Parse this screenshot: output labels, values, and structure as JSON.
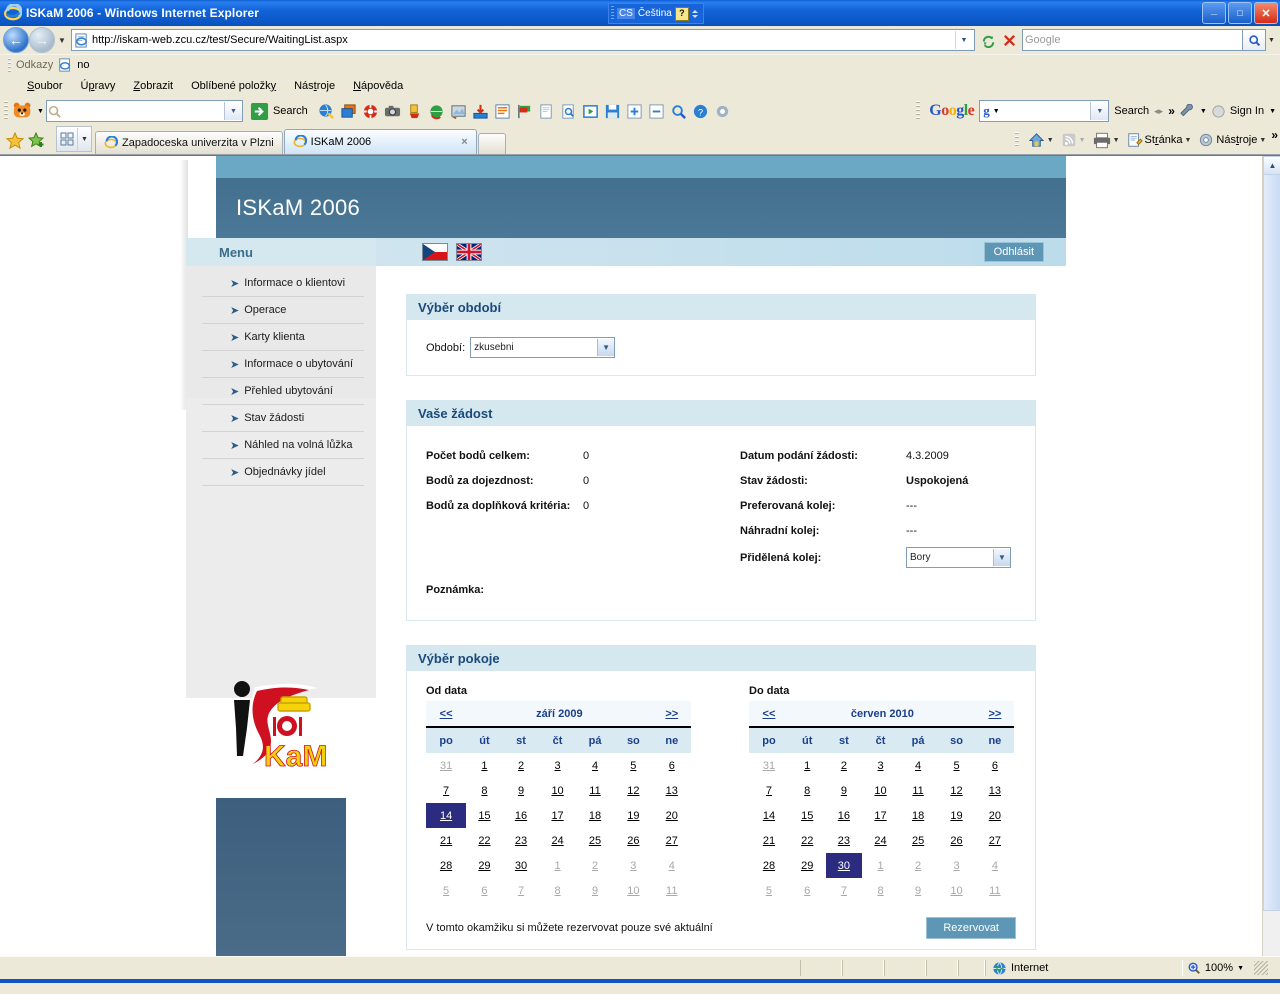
{
  "window": {
    "title": "ISKaM 2006 - Windows Internet Explorer",
    "ie_icon": "internet-explorer-icon",
    "minimize_label": "_",
    "maximize_label": "□",
    "close_label": "×",
    "lang_indicator": {
      "code": "CS",
      "name": "Čeština",
      "help": "?"
    }
  },
  "address_bar": {
    "url": "http://iskam-web.zcu.cz/test/Secure/WaitingList.aspx",
    "search_placeholder": "Google",
    "back_label": "←",
    "forward_label": "→",
    "refresh_label": "refresh-icon",
    "stop_label": "stop-icon",
    "go_label": "search-icon"
  },
  "links_bar": {
    "label": "Odkazy",
    "item": "no"
  },
  "menu_bar": {
    "items": [
      "Soubor",
      "Úpravy",
      "Zobrazit",
      "Oblíbené položky",
      "Nástroje",
      "Nápověda"
    ]
  },
  "toolbar": {
    "search_label": "Search",
    "search_value": "",
    "icons": [
      "globe-search-icon",
      "windows-icon",
      "lifebuoy-icon",
      "camera-icon",
      "highlighter-icon",
      "world-refresh-icon",
      "image-edit-icon",
      "download-icon",
      "list-icon",
      "flag-icon",
      "page-icon",
      "page-search-icon",
      "media-icon",
      "save-icon",
      "zoom-in-icon",
      "zoom-out-icon",
      "magnifier-icon",
      "help-icon",
      "gear-icon"
    ]
  },
  "google_bar": {
    "logo": [
      "G",
      "o",
      "o",
      "g",
      "l",
      "e"
    ],
    "box_value": "g",
    "search_label": "Search",
    "more_label": "»",
    "wrench_icon": "wrench-icon",
    "signin_label": "Sign In"
  },
  "tabs": {
    "favorites_icon": "star-icon",
    "add_favorite_icon": "add-star-icon",
    "quick_tabs_icon": "grid-icon",
    "items": [
      {
        "label": "Zapadoceska univerzita v Plzni",
        "active": false
      },
      {
        "label": "ISKaM 2006",
        "active": true,
        "close": "×"
      }
    ],
    "new_tab": ""
  },
  "command_bar": {
    "home_label": "home-icon",
    "feeds_label": "rss-icon",
    "print_label": "print-icon",
    "page_label": "Stránka",
    "tools_label": "Nástroje",
    "more_label": "»"
  },
  "page": {
    "header_title": "ISKaM 2006",
    "menu_title": "Menu",
    "logout_label": "Odhlásit",
    "flags": [
      "czech-flag",
      "uk-flag"
    ],
    "logo_text": "KaM",
    "menu_items": [
      "Informace o klientovi",
      "Operace",
      "Karty klienta",
      "Informace o ubytování",
      "Přehled ubytování",
      "Stav žádosti",
      "Náhled na volná lůžka",
      "Objednávky jídel"
    ],
    "period_panel": {
      "title": "Výběr období",
      "field_label": "Období:",
      "field_value": "zkusebni"
    },
    "request_panel": {
      "title": "Vaše žádost",
      "left": [
        {
          "label": "Počet bodů celkem:",
          "value": "0"
        },
        {
          "label": "Bodů za dojezdnost:",
          "value": "0"
        },
        {
          "label": "Bodů za doplňková kritéria:",
          "value": "0"
        }
      ],
      "right": [
        {
          "label": "Datum podání žádosti:",
          "value": "4.3.2009"
        },
        {
          "label": "Stav žádosti:",
          "value": "Uspokojená"
        },
        {
          "label": "Preferovaná kolej:",
          "value": "---"
        },
        {
          "label": "Náhradní kolej:",
          "value": "---"
        }
      ],
      "assigned_label": "Přidělená kolej:",
      "assigned_value": "Bory",
      "note_label": "Poznámka:"
    },
    "room_panel": {
      "title": "Výběr pokoje",
      "note_text": "V tomto okamžiku si můžete rezervovat pouze své aktuální",
      "reserve_label": "Rezervovat"
    }
  },
  "calendars": [
    {
      "caption": "Od data",
      "prev": "<<",
      "next": ">>",
      "title": "září 2009",
      "dow": [
        "po",
        "út",
        "st",
        "čt",
        "pá",
        "so",
        "ne"
      ],
      "selected": 14,
      "weeks": [
        [
          {
            "d": "31",
            "o": true
          },
          {
            "d": "1"
          },
          {
            "d": "2"
          },
          {
            "d": "3"
          },
          {
            "d": "4"
          },
          {
            "d": "5"
          },
          {
            "d": "6"
          }
        ],
        [
          {
            "d": "7"
          },
          {
            "d": "8"
          },
          {
            "d": "9"
          },
          {
            "d": "10"
          },
          {
            "d": "11"
          },
          {
            "d": "12"
          },
          {
            "d": "13"
          }
        ],
        [
          {
            "d": "14",
            "s": true
          },
          {
            "d": "15"
          },
          {
            "d": "16"
          },
          {
            "d": "17"
          },
          {
            "d": "18"
          },
          {
            "d": "19"
          },
          {
            "d": "20"
          }
        ],
        [
          {
            "d": "21"
          },
          {
            "d": "22"
          },
          {
            "d": "23"
          },
          {
            "d": "24"
          },
          {
            "d": "25"
          },
          {
            "d": "26"
          },
          {
            "d": "27"
          }
        ],
        [
          {
            "d": "28"
          },
          {
            "d": "29"
          },
          {
            "d": "30"
          },
          {
            "d": "1",
            "o": true
          },
          {
            "d": "2",
            "o": true
          },
          {
            "d": "3",
            "o": true
          },
          {
            "d": "4",
            "o": true
          }
        ],
        [
          {
            "d": "5",
            "o": true
          },
          {
            "d": "6",
            "o": true
          },
          {
            "d": "7",
            "o": true
          },
          {
            "d": "8",
            "o": true
          },
          {
            "d": "9",
            "o": true
          },
          {
            "d": "10",
            "o": true
          },
          {
            "d": "11",
            "o": true
          }
        ]
      ]
    },
    {
      "caption": "Do data",
      "prev": "<<",
      "next": ">>",
      "title": "červen 2010",
      "dow": [
        "po",
        "út",
        "st",
        "čt",
        "pá",
        "so",
        "ne"
      ],
      "selected": 30,
      "weeks": [
        [
          {
            "d": "31",
            "o": true
          },
          {
            "d": "1"
          },
          {
            "d": "2"
          },
          {
            "d": "3"
          },
          {
            "d": "4"
          },
          {
            "d": "5"
          },
          {
            "d": "6"
          }
        ],
        [
          {
            "d": "7"
          },
          {
            "d": "8"
          },
          {
            "d": "9"
          },
          {
            "d": "10"
          },
          {
            "d": "11"
          },
          {
            "d": "12"
          },
          {
            "d": "13"
          }
        ],
        [
          {
            "d": "14"
          },
          {
            "d": "15"
          },
          {
            "d": "16"
          },
          {
            "d": "17"
          },
          {
            "d": "18"
          },
          {
            "d": "19"
          },
          {
            "d": "20"
          }
        ],
        [
          {
            "d": "21"
          },
          {
            "d": "22"
          },
          {
            "d": "23"
          },
          {
            "d": "24"
          },
          {
            "d": "25"
          },
          {
            "d": "26"
          },
          {
            "d": "27"
          }
        ],
        [
          {
            "d": "28"
          },
          {
            "d": "29"
          },
          {
            "d": "30",
            "s": true
          },
          {
            "d": "1",
            "o": true
          },
          {
            "d": "2",
            "o": true
          },
          {
            "d": "3",
            "o": true
          },
          {
            "d": "4",
            "o": true
          }
        ],
        [
          {
            "d": "5",
            "o": true
          },
          {
            "d": "6",
            "o": true
          },
          {
            "d": "7",
            "o": true
          },
          {
            "d": "8",
            "o": true
          },
          {
            "d": "9",
            "o": true
          },
          {
            "d": "10",
            "o": true
          },
          {
            "d": "11",
            "o": true
          }
        ]
      ]
    }
  ],
  "status_bar": {
    "zone": "Internet",
    "zone_icon": "globe-icon",
    "zoom": "100%",
    "zoom_icon": "zoom-icon"
  },
  "colors": {
    "title_blue": "#0b55c4",
    "header_blue": "#43708f",
    "header_strip": "#6ba8c4",
    "panel_head": "#d5e7ef",
    "panel_title_text": "#1a4a7a",
    "button_blue": "#5e96b6",
    "selected_day": "#2b2b80",
    "chrome_bg": "#ece9d8"
  }
}
